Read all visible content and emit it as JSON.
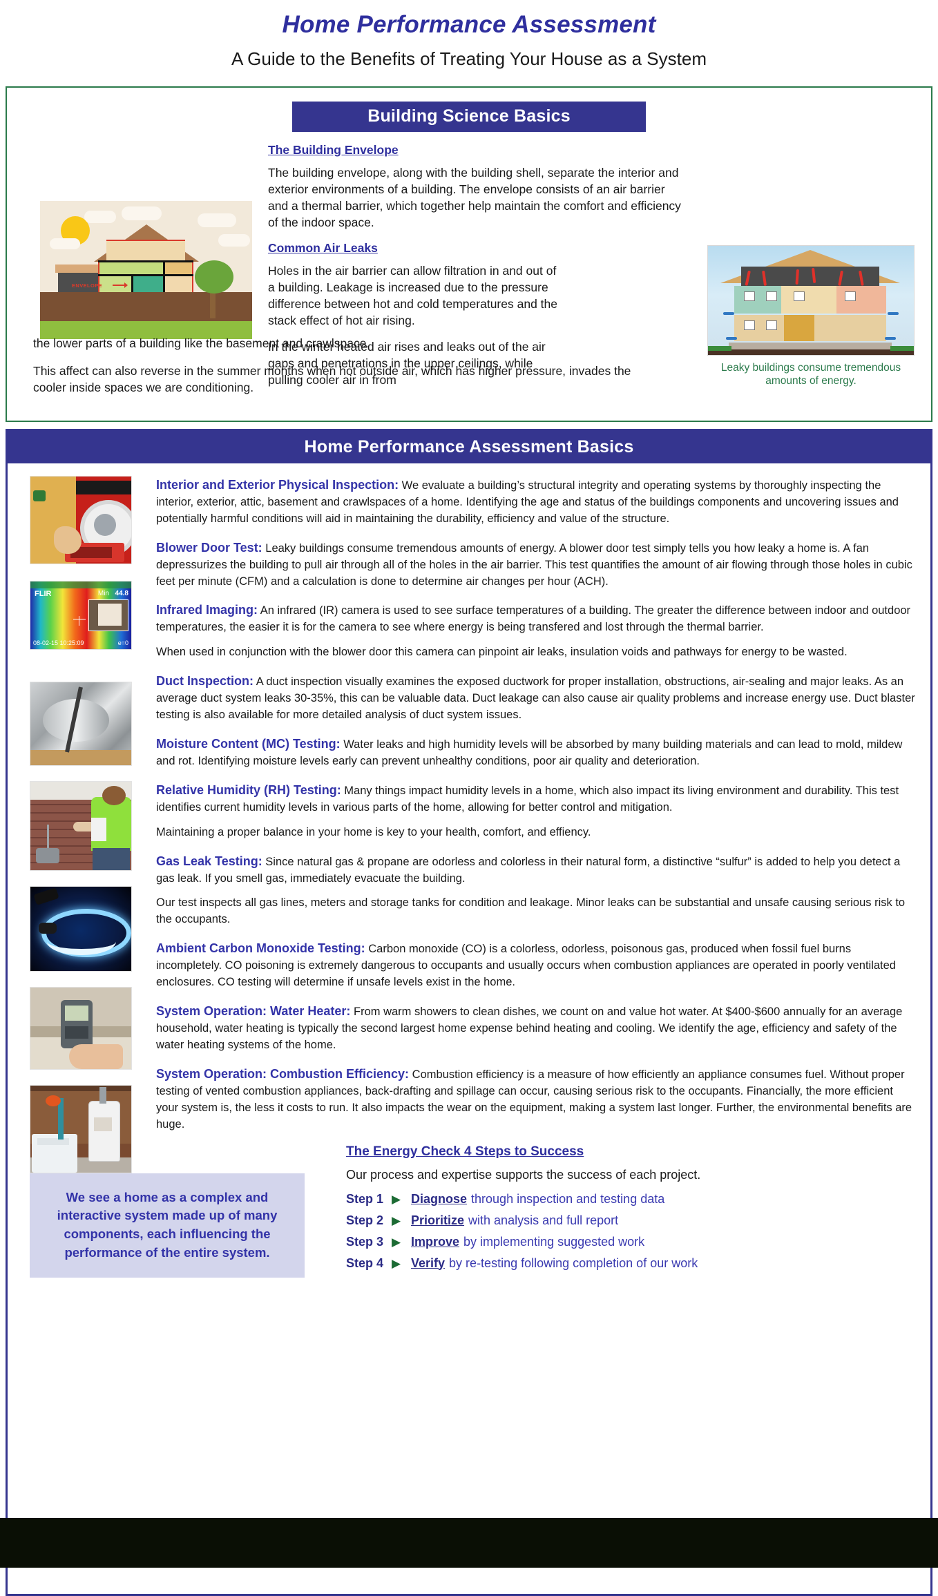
{
  "title": "Home Performance Assessment",
  "subtitle": "A Guide to the Benefits of Treating Your House as a System",
  "colors": {
    "brand_blue": "#35358f",
    "heading_blue": "#3333a8",
    "green_border": "#2b7a4b",
    "green_caption": "#2b7a4b",
    "quote_bg": "#d3d5ec",
    "arrow_green": "#1c6b34"
  },
  "section_one": {
    "banner": "Building Science Basics",
    "envelope_heading": "The Building Envelope",
    "envelope_paragraph": "The building envelope, along with the building shell, separate the interior and exterior environments of a building. The envelope consists of an air barrier and a thermal barrier, which together help maintain the comfort and efficiency of the indoor space.",
    "air_leaks_heading": "Common Air Leaks",
    "air_leaks_p1": "Holes in the air barrier can allow filtration in and out of a building. Leakage is increased due to the pressure difference between hot and cold temperatures and the stack effect of hot air rising.",
    "air_leaks_p2": "In the winter heated air rises and leaks out of the air gaps and penetrations in the upper ceilings, while pulling cooler air in from",
    "air_leaks_p2_wrap": "the lower parts of a building like the basement and crawlspace.",
    "air_leaks_p3": "This affect can also reverse in the summer months when hot outside air, which has higher pressure, invades the cooler inside spaces we are conditioning.",
    "house_illustration_label": "ENVELOPE",
    "leaky_caption": "Leaky buildings consume tremendous amounts of energy."
  },
  "section_two": {
    "banner": "Home Performance Assessment Basics",
    "items": [
      {
        "lead": "Interior and Exterior Physical Inspection:",
        "body": " We evaluate a building’s structural integrity and operating systems by thoroughly inspecting the interior, exterior, attic, basement and crawlspaces of a home. Identifying the age and status of the buildings components and uncovering issues and potentially harmful conditions will aid in maintaining the durability, efficiency and value of the structure."
      },
      {
        "lead": "Blower Door Test:",
        "body": " Leaky buildings consume tremendous amounts of energy. A blower door test simply tells you how leaky a home is. A fan depressurizes the building to pull air through all of the holes in the air barrier. This test quantifies the amount of air flowing through those holes in cubic feet per minute (CFM) and a calculation is done to determine air changes per hour (ACH)."
      },
      {
        "lead": "Infrared Imaging:",
        "body": " An infrared (IR) camera is used to see surface temperatures of a building. The greater the difference between indoor and outdoor temperatures, the easier it is for the camera to see where energy is being transfered and lost through the thermal barrier."
      },
      {
        "lead": "",
        "body": "When used in conjunction with the blower door this camera can pinpoint air leaks, insulation voids and pathways for energy to be wasted."
      },
      {
        "lead": "Duct Inspection:",
        "body": " A duct inspection visually examines the exposed ductwork for proper installation, obstructions, air-sealing and major leaks. As an average duct system leaks 30-35%, this can be valuable data. Duct leakage can also cause air quality problems and increase energy use. Duct blaster testing is also available for more detailed analysis of duct system issues."
      },
      {
        "lead": "Moisture Content (MC) Testing:",
        "body": " Water leaks and high humidity levels will be absorbed by many building materials and can lead to mold, mildew and rot. Identifying moisture levels early can prevent unhealthy conditions, poor air quality and deterioration."
      },
      {
        "lead": "Relative Humidity (RH) Testing:",
        "body": " Many things impact humidity levels in a home, which also impact its living environment and durability. This test identifies current humidity levels in various parts of the home, allowing for better control and mitigation."
      },
      {
        "lead": "",
        "body": "Maintaining a proper balance in your home is key to your health, comfort, and effiency."
      },
      {
        "lead": "Gas Leak Testing:",
        "body": " Since natural gas & propane are odorless and colorless in their natural form, a distinctive “sulfur”  is added to help you detect a gas leak.  If you smell gas, immediately evacuate the building."
      },
      {
        "lead": "",
        "body": "Our test inspects all gas lines, meters and storage tanks for condition and leakage. Minor leaks can be substantial and unsafe causing serious risk to the occupants."
      },
      {
        "lead": "Ambient Carbon Monoxide Testing:",
        "body": " Carbon monoxide (CO) is a colorless, odorless, poisonous gas, produced when fossil fuel burns incompletely. CO poisoning is extremely dangerous to occupants and usually occurs when combustion appliances are operated in poorly ventilated enclosures. CO testing will determine if unsafe levels exist in the home."
      },
      {
        "lead": "System Operation: Water Heater:",
        "body": " From warm showers to clean dishes, we count on and value hot water.  At $400-$600 annually for an average household, water heating is typically the second largest home expense behind heating and cooling. We identify the age, efficiency and safety of the water heating systems of the home."
      },
      {
        "lead": "System Operation: Combustion Efficiency:",
        "body": " Combustion efficiency is a measure of how efficiently an appliance consumes fuel. Without proper testing of vented combustion appliances, back-drafting and spillage can occur, causing serious risk to the occupants. Financially, the more efficient your system is, the less it costs to run. It also impacts the wear on the equipment, making a system last longer. Further, the environmental benefits are huge."
      }
    ],
    "photo_captions": [
      "blower-door-technician-photo",
      "flir-infrared-thermal-image",
      "flexible-ductwork-photo",
      "technician-at-brick-wall-photo",
      "blue-gas-burner-flame-photo",
      "handheld-co-meter-photo",
      "basement-water-heater-photo"
    ],
    "thermal_overlay": {
      "brand": "FLIR",
      "min_label": "Min",
      "min_value": "44.8",
      "timestamp": "08-02-15 10:25:09",
      "emissivity": "e=0"
    }
  },
  "bottom": {
    "quote": "We see a home as a complex and interactive system made up of many components, each influencing the performance of the entire system.",
    "steps_title": "The Energy Check 4 Steps to Success",
    "steps_intro": "Our process and expertise supports the success of each project.",
    "arrow_glyph": "▶",
    "steps": [
      {
        "label": "Step 1",
        "verb": "Diagnose",
        "text": "through inspection and testing data"
      },
      {
        "label": "Step 2",
        "verb": "Prioritize",
        "text": "with analysis and full report"
      },
      {
        "label": "Step 3",
        "verb": "Improve",
        "text": "by implementing suggested work"
      },
      {
        "label": "Step 4",
        "verb": "Verify",
        "text": "by re-testing following completion of our work"
      }
    ]
  }
}
